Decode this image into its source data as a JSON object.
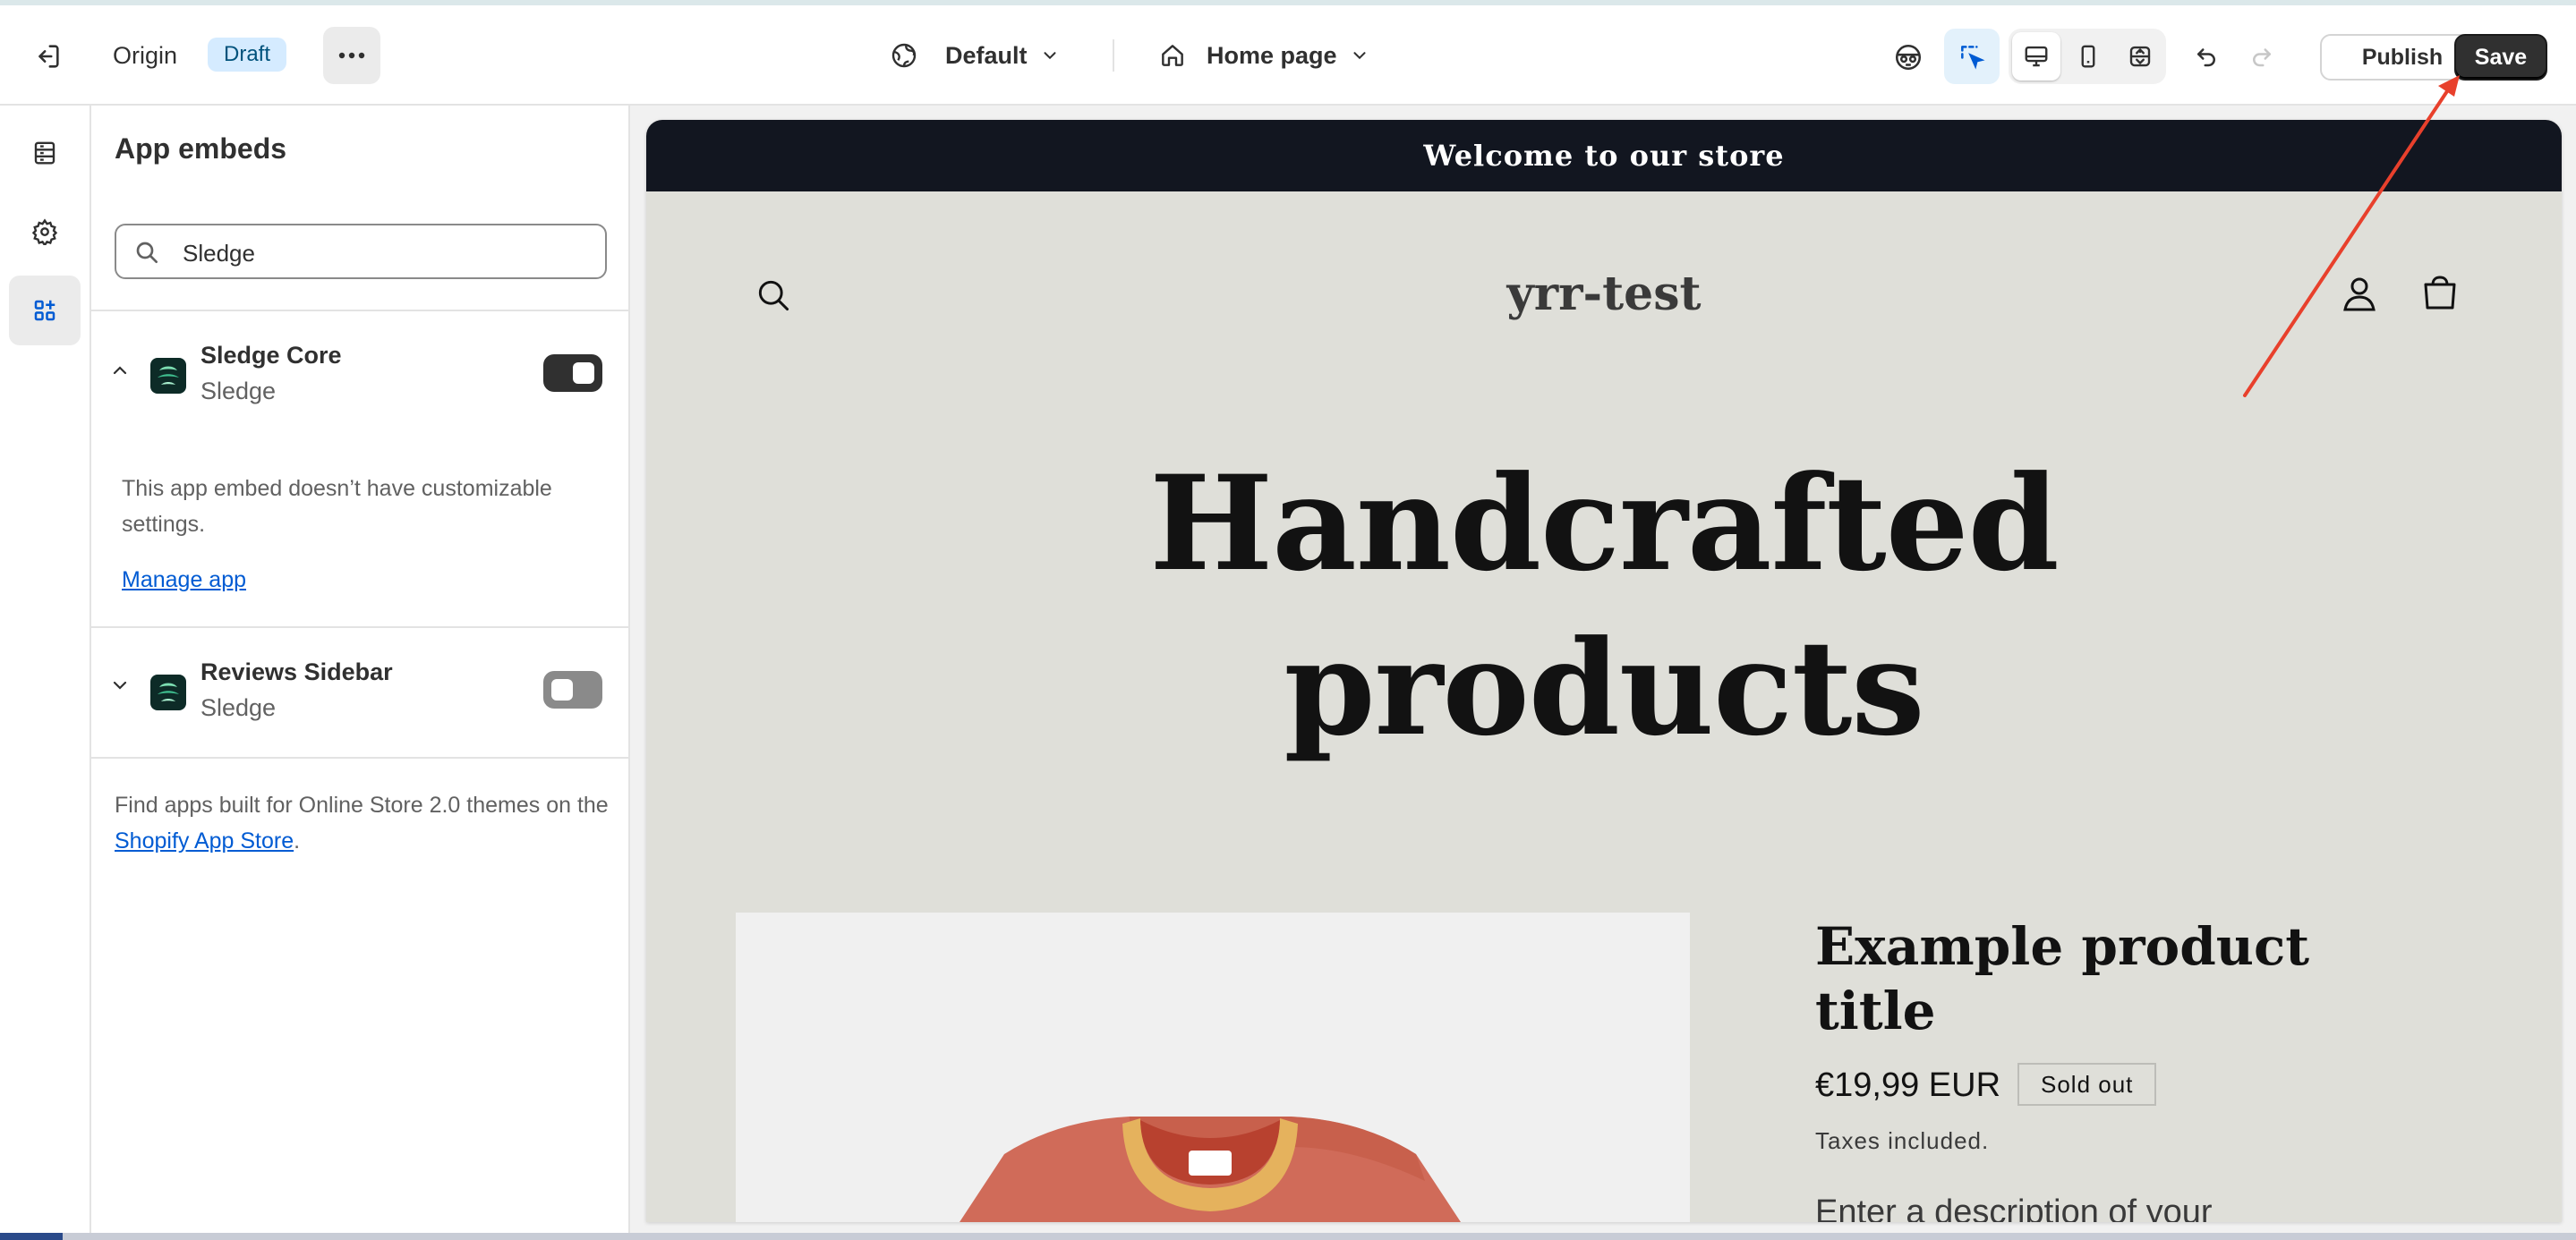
{
  "topbar": {
    "store_name": "Origin",
    "status_badge": "Draft",
    "theme_selector": "Default",
    "page_selector": "Home page",
    "publish_label": "Publish",
    "save_label": "Save"
  },
  "icons": {
    "exit": "exit-icon",
    "more": "more-horizontal-icon",
    "theme": "globe-icon",
    "page": "home-icon",
    "preview_inspector": "eye-mask-icon",
    "selector": "select-cursor-icon",
    "desktop": "desktop-icon",
    "mobile": "mobile-icon",
    "fullscreen": "fullscreen-icon",
    "undo": "undo-icon",
    "redo": "redo-icon"
  },
  "rail": {
    "items": [
      "sections-icon",
      "settings-gear-icon",
      "app-embeds-icon"
    ],
    "selected": "app-embeds-icon"
  },
  "panel": {
    "title": "App embeds",
    "search_value": "Sledge",
    "apps": [
      {
        "name": "Sledge Core",
        "provider": "Sledge",
        "enabled": true,
        "expanded": true
      },
      {
        "name": "Reviews Sidebar",
        "provider": "Sledge",
        "enabled": false,
        "expanded": false
      }
    ],
    "no_settings_note": "This app embed doesn’t have customizable settings.",
    "manage_link": "Manage app",
    "footer_prefix": "Find apps built for Online Store 2.0 themes on the ",
    "footer_link": "Shopify App Store",
    "footer_suffix": "."
  },
  "preview": {
    "announcement": "Welcome to our store",
    "store_name": "yrr-test",
    "hero_line1": "Handcrafted",
    "hero_line2": "products",
    "product_title": "Example product title",
    "price": "€19,99 EUR",
    "sold_out": "Sold out",
    "taxes": "Taxes included.",
    "description": "Enter a description of your"
  },
  "colors": {
    "accent_blue": "#005bd3",
    "save_button": "#303030",
    "announcement_bar": "#121620",
    "preview_bg": "#dfdfd9",
    "annotation_arrow": "#e8402c"
  }
}
